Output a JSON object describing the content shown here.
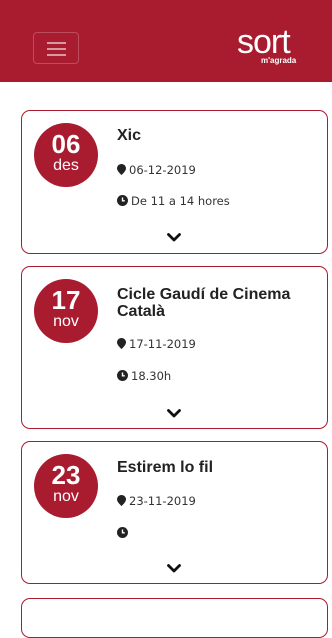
{
  "header": {
    "brand": "sort",
    "tagline": "m'agrada",
    "menu_icon": "hamburger-menu-icon",
    "background": "#a91b2f"
  },
  "events": [
    {
      "day": "06",
      "month": "des",
      "title": "Xic",
      "date": "06-12-2019",
      "time": "De 11 a 14 hores"
    },
    {
      "day": "17",
      "month": "nov",
      "title": "Cicle Gaudí de Cinema Català",
      "date": "17-11-2019",
      "time": "18.30h"
    },
    {
      "day": "23",
      "month": "nov",
      "title": "Estirem lo fil",
      "date": "23-11-2019",
      "time": ""
    }
  ],
  "icons": {
    "location": "map-marker-icon",
    "time": "clock-icon",
    "expand": "chevron-down-icon"
  },
  "colors": {
    "accent": "#a91b2f",
    "text": "#222222"
  }
}
